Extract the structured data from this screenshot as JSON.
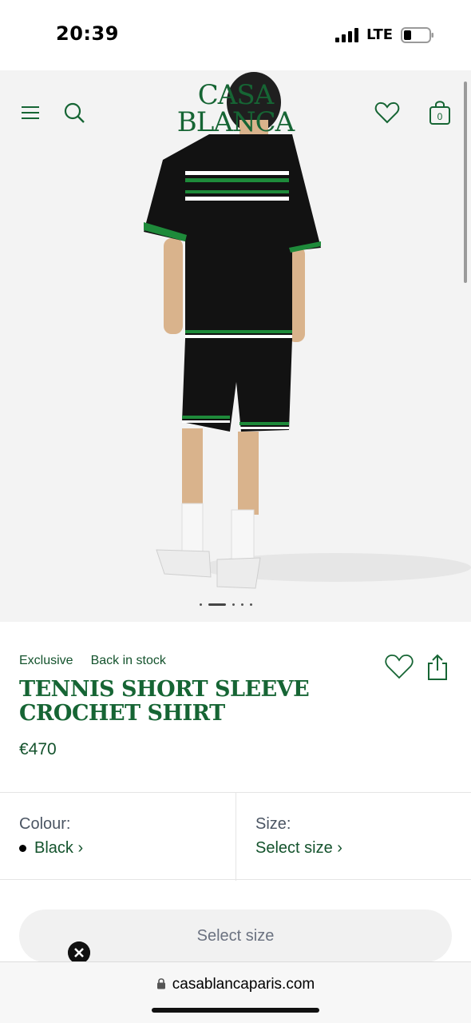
{
  "status_bar": {
    "time": "20:39",
    "network": "LTE"
  },
  "header": {
    "logo_line1": "CASA",
    "logo_line2": "BLANCA",
    "bag_count": "0",
    "brand_color": "#166534"
  },
  "gallery": {
    "slide_count": 5,
    "active_slide": 2
  },
  "product": {
    "tags": [
      "Exclusive",
      "Back in stock"
    ],
    "title_line1": "TENNIS SHORT SLEEVE",
    "title_line2": "CROCHET SHIRT",
    "price": "€470"
  },
  "options": {
    "colour_label": "Colour:",
    "colour_value": "Black ›",
    "size_label": "Size:",
    "size_value": "Select size ›"
  },
  "cta": {
    "label": "Select size"
  },
  "browser": {
    "url": "casablancaparis.com"
  }
}
